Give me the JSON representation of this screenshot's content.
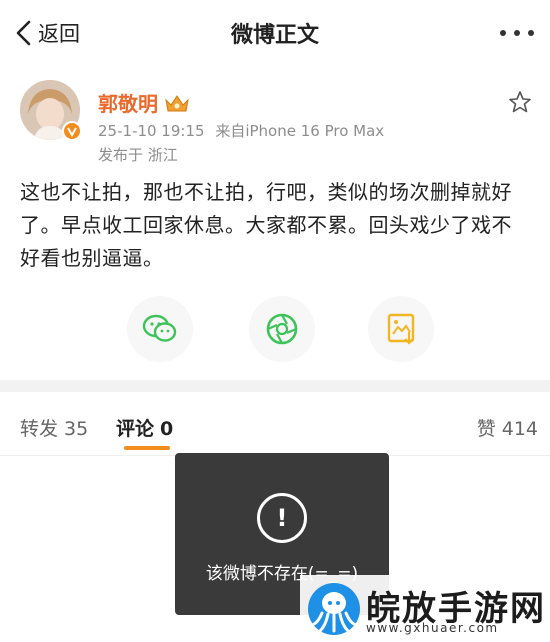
{
  "header": {
    "back_label": "返回",
    "title": "微博正文"
  },
  "post": {
    "username": "郭敬明",
    "time": "25-1-10 19:15",
    "source": "来自iPhone 16 Pro Max",
    "location": "发布于 浙江",
    "content": "这也不让拍，那也不让拍，行吧，类似的场次删掉就好了。早点收工回家休息。大家都不累。回头戏少了戏不好看也别逼逼。"
  },
  "share": {
    "icons": [
      "wechat-icon",
      "moments-icon",
      "save-image-icon"
    ]
  },
  "tabs": {
    "repost_label": "转发",
    "repost_count": "35",
    "comment_label": "评论",
    "comment_count": "0",
    "like_label": "赞",
    "like_count": "414"
  },
  "toast": {
    "icon": "!",
    "message": "该微博不存在(=_=)"
  },
  "watermark": {
    "name": "皖放手游网",
    "url": "www.gxhuaer.com"
  },
  "colors": {
    "accent": "#f28c1c",
    "username": "#e96a2c",
    "wechat_green": "#3ec25a",
    "save_yellow": "#f2b623"
  }
}
